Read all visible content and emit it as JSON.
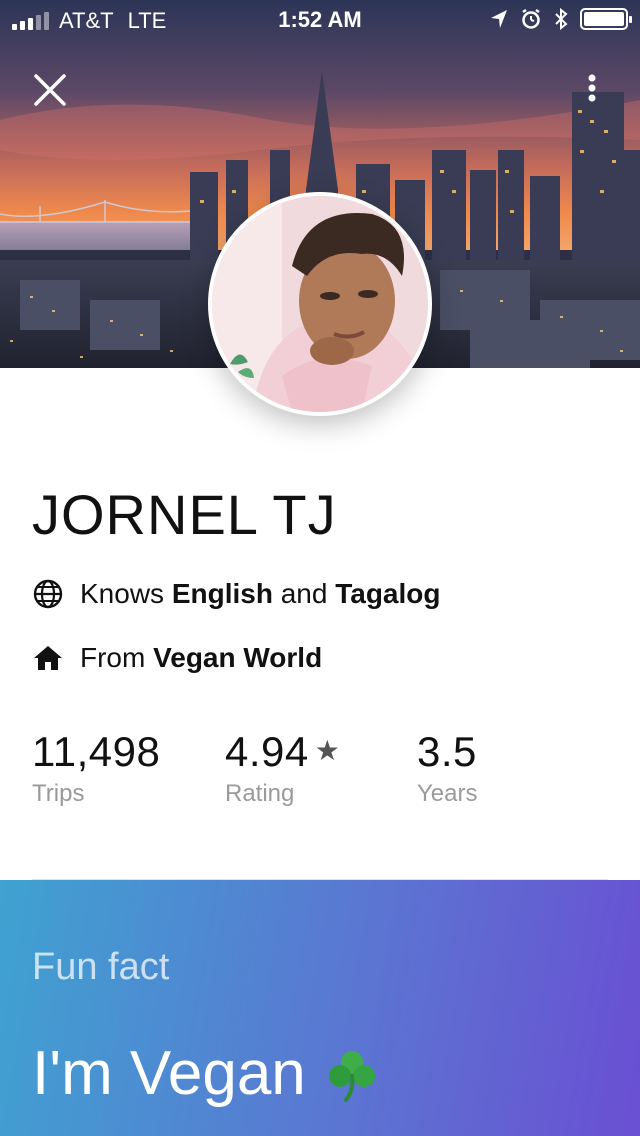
{
  "status_bar": {
    "carrier": "AT&T",
    "network": "LTE",
    "time": "1:52 AM",
    "icons": [
      "signal-bars-icon",
      "location-arrow-icon",
      "alarm-icon",
      "bluetooth-icon",
      "battery-icon"
    ]
  },
  "header": {
    "icons": [
      "close-icon",
      "more-vertical-icon"
    ],
    "cover_image": "city-skyline-sunset"
  },
  "profile": {
    "name": "JORNEL TJ",
    "languages": {
      "prefix": "Knows ",
      "first": "English",
      "conjunction": " and ",
      "second": "Tagalog",
      "icon": "globe-icon"
    },
    "hometown": {
      "prefix": "From ",
      "place": "Vegan World",
      "icon": "home-icon"
    }
  },
  "stats": [
    {
      "value": "11,498",
      "label": "Trips"
    },
    {
      "value": "4.94",
      "label": "Rating",
      "icon": "star-icon"
    },
    {
      "value": "3.5",
      "label": "Years"
    }
  ],
  "fun_fact": {
    "label": "Fun fact",
    "text": "I'm Vegan",
    "emoji_icon": "shamrock-icon"
  },
  "colors": {
    "gradient_start": "#3fa2d1",
    "gradient_end": "#6a4fd3",
    "label_gray": "#9a9a9a"
  }
}
